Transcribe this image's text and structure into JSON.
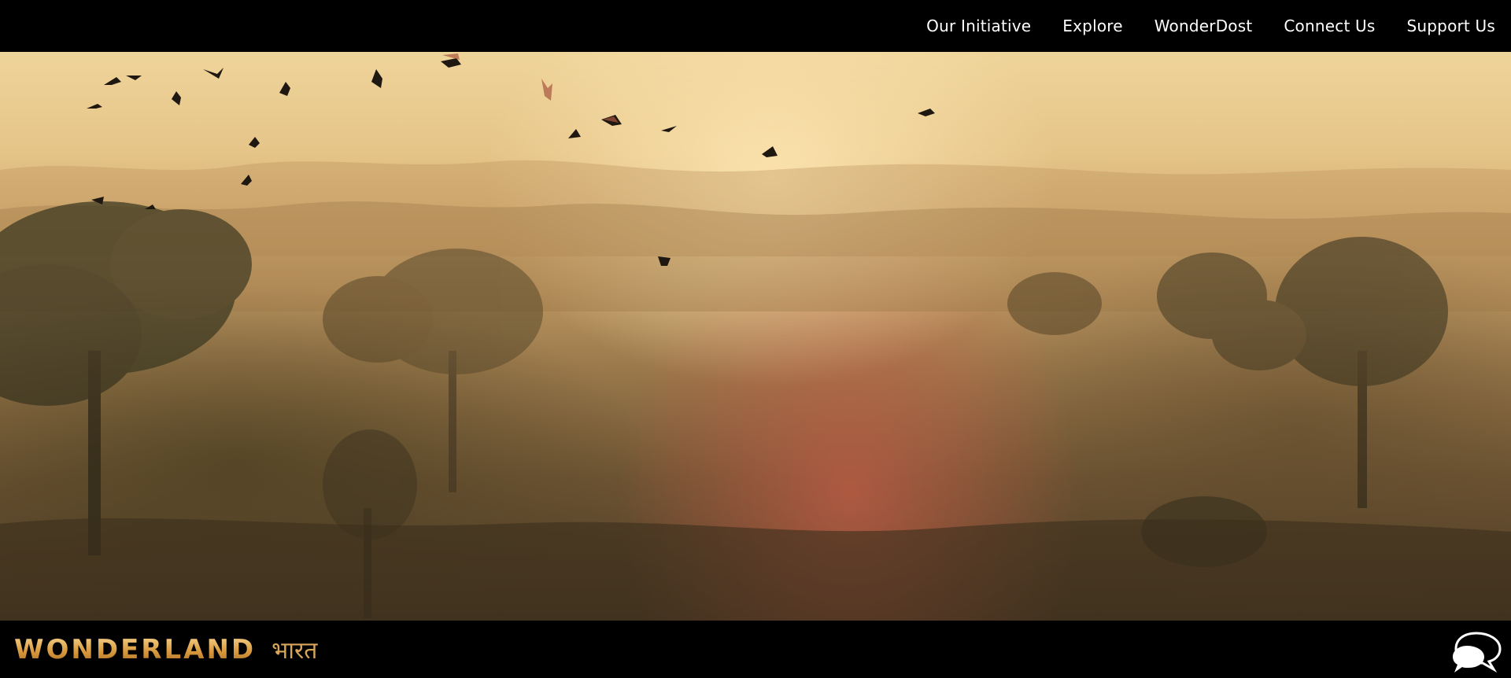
{
  "nav": {
    "items": [
      {
        "label": "Our Initiative"
      },
      {
        "label": "Explore"
      },
      {
        "label": "WonderDost"
      },
      {
        "label": "Connect Us"
      },
      {
        "label": "Support Us"
      }
    ]
  },
  "footer": {
    "logo_main": "WONDERLAND",
    "logo_sub": "भारत"
  },
  "icons": {
    "chat": "chat-bubbles-icon"
  },
  "colors": {
    "bar_background": "#000000",
    "nav_text": "#ffffff",
    "logo_gold": "#d9a14a"
  }
}
